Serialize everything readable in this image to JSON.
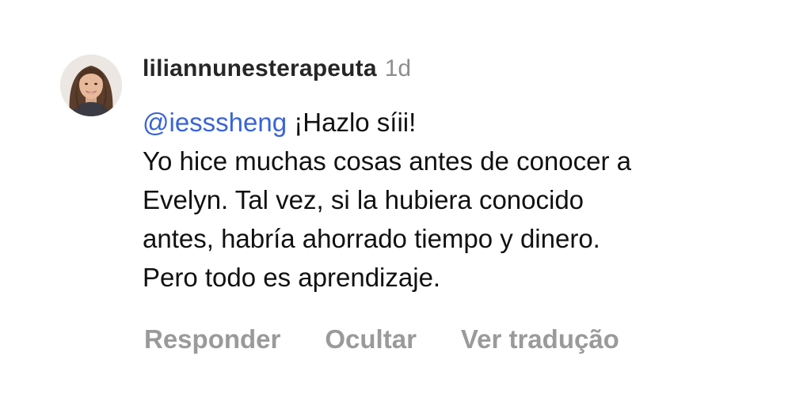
{
  "comment": {
    "username": "liliannunesterapeuta",
    "timestamp": "1d",
    "mention": "@iesssheng",
    "first_line_rest": "¡Hazlo síii!",
    "lines": [
      "Yo hice muchas cosas antes de conocer a",
      "Evelyn. Tal vez, si la hubiera conocido",
      "antes, habría ahorrado tiempo y dinero.",
      "Pero todo es aprendizaje."
    ],
    "colors": {
      "mention": "#3a63d8",
      "username": "#262626",
      "timestamp": "#8e8e8e",
      "action": "#9a9a9a"
    }
  },
  "actions": {
    "reply_label": "Responder",
    "hide_label": "Ocultar",
    "translate_label": "Ver tradução"
  }
}
